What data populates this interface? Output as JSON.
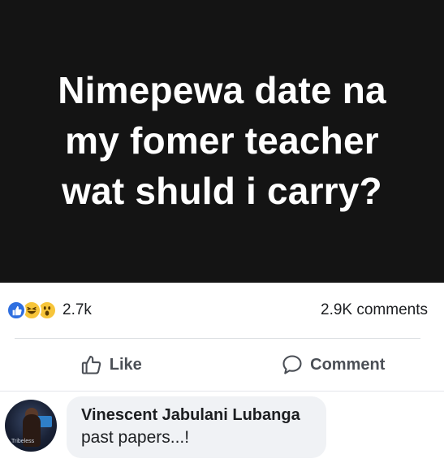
{
  "post": {
    "banner_text": "Nimepewa date na my fomer teacher wat shuld i carry?"
  },
  "reactions": {
    "icons": [
      "like-icon",
      "haha-icon",
      "wow-icon"
    ],
    "count": "2.7k",
    "comments_count": "2.9K comments"
  },
  "actions": {
    "like_label": "Like",
    "comment_label": "Comment"
  },
  "comment": {
    "author": "Vinescent Jabulani Lubanga",
    "text": "past papers...!",
    "avatar_tag": "Tribeless"
  },
  "colors": {
    "banner_bg": "#141414",
    "like_blue": "#2f6fe0",
    "emoji_yellow": "#f7c53a",
    "bubble_bg": "#f0f2f5",
    "action_gray": "#4b4f56"
  }
}
